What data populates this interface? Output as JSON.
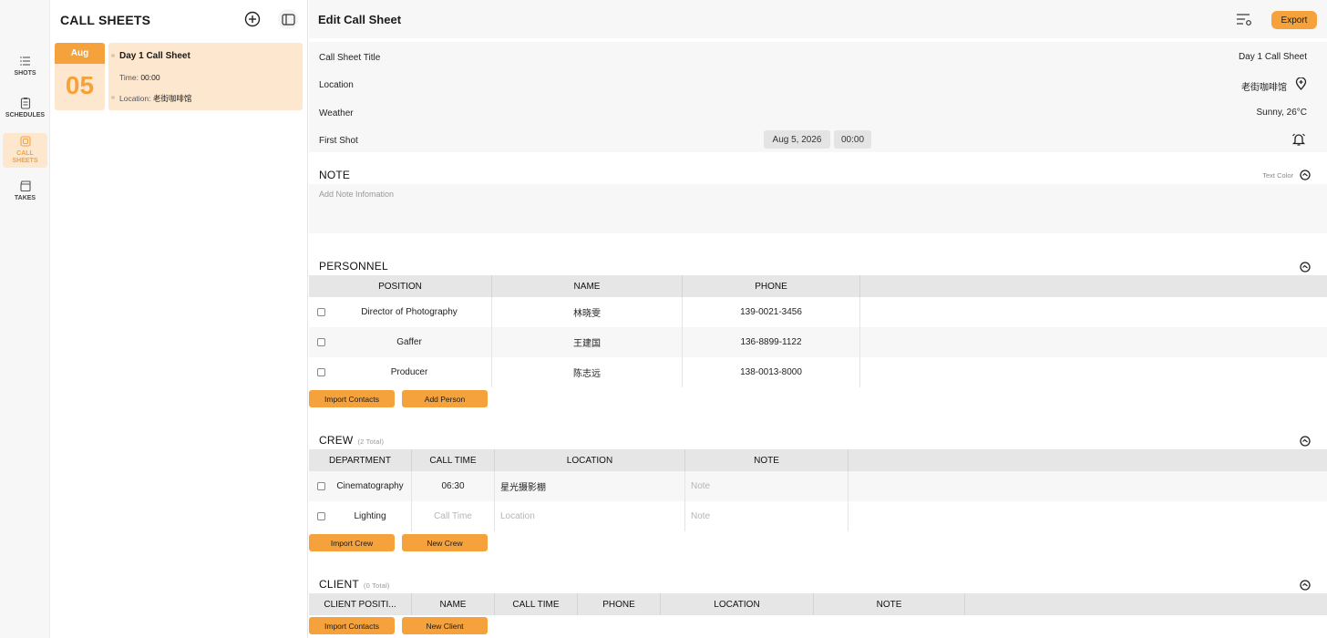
{
  "rail": {
    "items": [
      {
        "label": "SHOTS",
        "icon": "list-icon"
      },
      {
        "label": "SCHEDULES",
        "icon": "clipboard-icon"
      },
      {
        "label": "CALL SHEETS",
        "icon": "callsheet-icon"
      },
      {
        "label": "TAKES",
        "icon": "clapperboard-icon"
      }
    ],
    "active": "CALL SHEETS"
  },
  "list_panel": {
    "title": "CALL SHEETS",
    "date": {
      "month": "Aug",
      "day": "05"
    },
    "card": {
      "title": "Day 1 Call Sheet",
      "time_label": "Time:",
      "time_value": "00:00",
      "location_label": "Location:",
      "location_value": "老街咖啡馆"
    }
  },
  "main": {
    "title": "Edit Call Sheet",
    "export_label": "Export",
    "info": {
      "title_label": "Call Sheet Title",
      "title_value": "Day 1 Call Sheet",
      "location_label": "Location",
      "location_value": "老街咖啡馆",
      "weather_label": "Weather",
      "weather_value": "Sunny, 26°C",
      "first_shot_label": "First Shot",
      "first_shot_date": "Aug 5, 2026",
      "first_shot_time": "00:00"
    },
    "note": {
      "title": "NOTE",
      "text_color_label": "Text Color",
      "placeholder": "Add Note Infomation"
    },
    "personnel": {
      "title": "PERSONNEL",
      "columns": [
        "POSITION",
        "NAME",
        "PHONE"
      ],
      "rows": [
        [
          "Director of Photography",
          "林晓雯",
          "139-0021-3456"
        ],
        [
          "Gaffer",
          "王建国",
          "136-8899-1122"
        ],
        [
          "Producer",
          "陈志远",
          "138-0013-8000"
        ]
      ],
      "buttons": [
        "Import Contacts",
        "Add Person"
      ]
    },
    "crew": {
      "title": "CREW",
      "total": "(2 Total)",
      "columns": [
        "DEPARTMENT",
        "CALL TIME",
        "LOCATION",
        "NOTE"
      ],
      "rows": [
        [
          "Cinematography",
          "06:30",
          "星光摄影棚",
          ""
        ],
        [
          "Lighting",
          "",
          "",
          ""
        ]
      ],
      "placeholders": {
        "call_time": "Call Time",
        "location": "Location",
        "note": "Note"
      },
      "buttons": [
        "Import Crew",
        "New Crew"
      ]
    },
    "client": {
      "title": "CLIENT",
      "total": "(0 Total)",
      "columns": [
        "CLIENT POSITI...",
        "NAME",
        "CALL TIME",
        "PHONE",
        "LOCATION",
        "NOTE"
      ],
      "buttons": [
        "Import Contacts",
        "New Client"
      ]
    }
  },
  "colors": {
    "accent": "#f5a23d",
    "accent_light": "#fde7cf",
    "panel_bg": "#f7f7f7",
    "header_bg": "#e6e6e6"
  }
}
